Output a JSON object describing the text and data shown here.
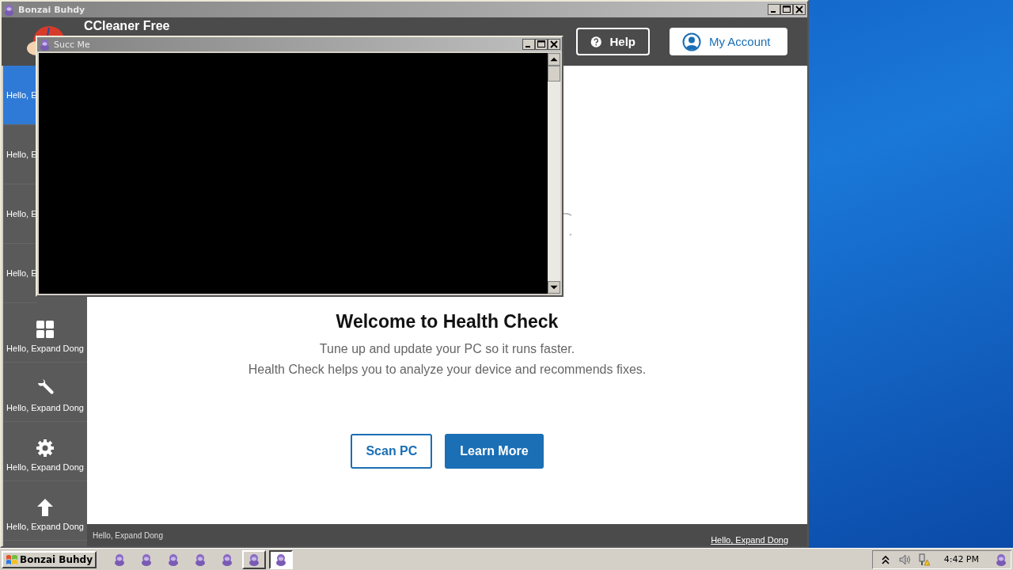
{
  "main_window": {
    "title": "Bonzai Buhdy",
    "app_name": "CCleaner Free",
    "header_buttons": [
      {
        "label": "Help",
        "kind": "outline"
      },
      {
        "label": "My Account",
        "kind": "filled"
      }
    ],
    "sidebar": {
      "items": [
        {
          "label": "Hello, E",
          "selected": true
        },
        {
          "label": "Hello, E",
          "selected": false
        },
        {
          "label": "Hello, E",
          "selected": false
        },
        {
          "label": "Hello, E",
          "selected": false
        },
        {
          "label": "Hello, Expand Dong",
          "selected": false
        },
        {
          "label": "Hello, Expand Dong",
          "selected": false
        },
        {
          "label": "Hello, Expand Dong",
          "selected": false
        },
        {
          "label": "Hello, Expand Dong",
          "selected": false
        }
      ]
    },
    "content": {
      "title": "Welcome to Health Check",
      "lines": [
        "Tune up and update your PC so it runs faster.",
        "Health Check helps you to analyze your device and recommends fixes."
      ],
      "buttons": [
        {
          "label": "Scan PC",
          "kind": "outline"
        },
        {
          "label": "Learn More",
          "kind": "filled"
        }
      ]
    },
    "footer": {
      "text": "Hello, Expand Dong",
      "link": "Hello, Expand Dong"
    }
  },
  "console_window": {
    "title": "Succ Me"
  },
  "taskbar": {
    "start_label": "Bonzai Buhdy",
    "buttons": [
      {
        "kind": "plain",
        "selected": false
      },
      {
        "kind": "plain",
        "selected": false
      },
      {
        "kind": "plain",
        "selected": false
      },
      {
        "kind": "plain",
        "selected": false
      },
      {
        "kind": "plain",
        "selected": false
      },
      {
        "kind": "raised",
        "selected": false
      },
      {
        "kind": "raised",
        "selected": true
      }
    ],
    "time": "4:42 PM"
  }
}
